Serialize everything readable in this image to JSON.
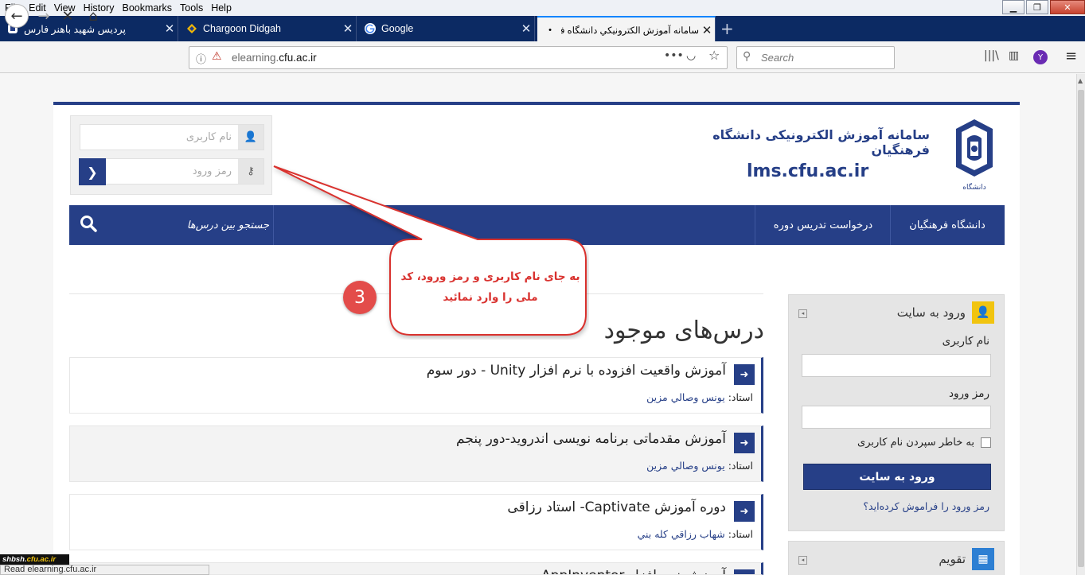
{
  "menubar": {
    "items": [
      "File",
      "Edit",
      "View",
      "History",
      "Bookmarks",
      "Tools",
      "Help"
    ]
  },
  "tabs": [
    {
      "title": "پردیس شهید باهنر فارس",
      "close": "✕"
    },
    {
      "title": "Chargoon Didgah",
      "close": "✕"
    },
    {
      "title": "Google",
      "close": "✕"
    },
    {
      "title": "سامانه آموزش الکترونیکي دانشگاه فرهنگیان",
      "close": "✕"
    }
  ],
  "newtab": "+",
  "nav": {
    "url_prefix": "elearning.",
    "url_domain": "cfu.ac.ir",
    "search_placeholder": "Search",
    "profile_letter": "Y"
  },
  "header": {
    "site_title": "سامانه آموزش الکترونیکی دانشگاه فرهنگیان",
    "site_url": "lms.cfu.ac.ir",
    "logo_text": "دانشگاه فرهنگیان"
  },
  "quick_login": {
    "username_placeholder": "نام کاربری",
    "password_placeholder": "رمز ورود"
  },
  "site_nav": {
    "item1": "دانشگاه فرهنگیان",
    "item2": "درخواست تدریس دوره",
    "search": "جستجو بین درس‌ها"
  },
  "callout": {
    "text": "به جای نام کاربری و رمز ورود، کد ملی را وارد نمائید",
    "number": "3"
  },
  "courses_title": "درس‌های موجود",
  "courses": [
    {
      "title": "آموزش واقعیت افزوده با نرم افزار Unity  - دور سوم",
      "teacher_label": "استاد: ",
      "teacher": "یونس وصالي مزین"
    },
    {
      "title": "آموزش مقدماتی برنامه نویسی اندروید-دور پنجم",
      "teacher_label": "استاد: ",
      "teacher": "یونس وصالي مزین"
    },
    {
      "title": "دوره آموزش Captivate-  استاد رزاقی",
      "teacher_label": "استاد: ",
      "teacher": "شهاب رزاقي كله بني"
    },
    {
      "title": "آموزش نرم افزار AppInventor",
      "teacher_label": "",
      "teacher": ""
    }
  ],
  "login_block": {
    "title": "ورود به سایت",
    "username_label": "نام کاربری",
    "password_label": "رمز ورود",
    "remember": "به خاطر سپردن نام کاربری",
    "button": "ورود به سایت",
    "forgot": "رمز ورود را فراموش کرده‌اید؟"
  },
  "calendar_block": {
    "title": "تقویم"
  },
  "watermark": {
    "prefix": "shbsh.",
    "brand": "cfu.ac.ir"
  },
  "status": "Read elearning.cfu.ac.ir",
  "colors": {
    "primary": "#263f87",
    "callout_text": "#d9322f",
    "badge": "#e34c4a",
    "login_icon": "#f1c40f",
    "calendar_icon": "#2d7fd3"
  }
}
